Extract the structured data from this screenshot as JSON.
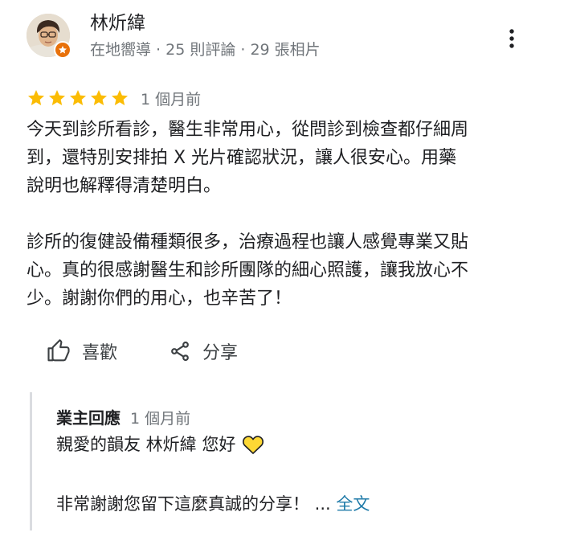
{
  "review": {
    "author": {
      "name": "林炘緯",
      "meta": "在地嚮導 · 25 則評論 · 29 張相片",
      "avatar_icon": "avatar-illustration",
      "badge_icon": "local-guide-star-icon",
      "badge_color": "#e8710a"
    },
    "menu_icon": "more-vert-icon",
    "rating": 5,
    "rating_max": 5,
    "star_color": "#fbbc04",
    "time": "1 個月前",
    "paragraphs": [
      [
        "今天到診所看診，醫生非常用心，從問診到檢查都仔細周",
        "到，還特別安排拍 X 光片確認狀況，讓人很安心。用藥",
        "說明也解釋得清楚明白。"
      ],
      [
        "診所的復健設備種類很多，治療過程也讓人感覺專業又貼",
        "心。真的很感謝醫生和診所團隊的細心照護，讓我放心不",
        "少。謝謝你們的用心，也辛苦了！"
      ]
    ],
    "actions": {
      "like": {
        "label": "喜歡",
        "icon": "thumb-up-icon"
      },
      "share": {
        "label": "分享",
        "icon": "share-icon"
      }
    }
  },
  "reply": {
    "owner_label": "業主回應",
    "time": "1 個月前",
    "line1": "親愛的韻友 林炘緯 您好",
    "line1_icon": "yellow-heart-icon",
    "heart_color": "#fdd835",
    "line2": "非常謝謝您留下這麼真誠的分享！ ... ",
    "more_label": "全文",
    "more_color": "#1e7aa8"
  }
}
